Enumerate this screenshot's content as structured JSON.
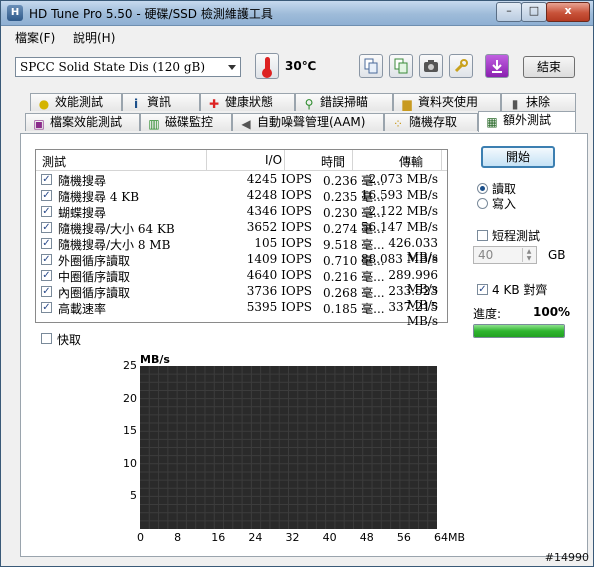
{
  "window": {
    "title": "HD Tune Pro 5.50 - 硬碟/SSD 檢測維護工具",
    "min_label": "–",
    "max_label": "□",
    "close_label": "x"
  },
  "menu": {
    "items": [
      {
        "label": "檔案(F)"
      },
      {
        "label": "說明(H)"
      }
    ]
  },
  "toolbar": {
    "drive": "SPCC Solid State Dis (120 gB)",
    "temperature": "30℃",
    "exit_label": "結束"
  },
  "tabs": {
    "row1": [
      {
        "label": "效能測試",
        "icon": "bulb-icon"
      },
      {
        "label": "資訊",
        "icon": "info-icon"
      },
      {
        "label": "健康狀態",
        "icon": "health-cross-icon"
      },
      {
        "label": "錯誤掃瞄",
        "icon": "magnifier-icon"
      },
      {
        "label": "資料夾使用",
        "icon": "folder-icon"
      },
      {
        "label": "抹除",
        "icon": "trash-icon"
      }
    ],
    "row2": [
      {
        "label": "檔案效能測試",
        "icon": "file-benchmark-icon"
      },
      {
        "label": "磁碟監控",
        "icon": "chart-icon"
      },
      {
        "label": "自動噪聲管理(AAM)",
        "icon": "speaker-icon"
      },
      {
        "label": "隨機存取",
        "icon": "dots-icon"
      },
      {
        "label": "額外測試",
        "icon": "calendar-icon",
        "active": true
      }
    ]
  },
  "table": {
    "headers": {
      "test": "測試",
      "io": "I/O",
      "time": "時間",
      "speed": "傳輸"
    },
    "rows": [
      {
        "name": "隨機搜尋",
        "io": "4245 IOPS",
        "time": "0.236 毫...",
        "speed": "2.073 MB/s"
      },
      {
        "name": "隨機搜尋 4 KB",
        "io": "4248 IOPS",
        "time": "0.235 毫...",
        "speed": "16.593 MB/s"
      },
      {
        "name": "蝴蝶搜尋",
        "io": "4346 IOPS",
        "time": "0.230 毫...",
        "speed": "2.122 MB/s"
      },
      {
        "name": "隨機搜尋/大小 64 KB",
        "io": "3652 IOPS",
        "time": "0.274 毫...",
        "speed": "56.147 MB/s"
      },
      {
        "name": "隨機搜尋/大小 8 MB",
        "io": "105 IOPS",
        "time": "9.518 毫...",
        "speed": "426.033 MB/s"
      },
      {
        "name": "外圈循序讀取",
        "io": "1409 IOPS",
        "time": "0.710 毫...",
        "speed": "88.083 MB/s"
      },
      {
        "name": "中圈循序讀取",
        "io": "4640 IOPS",
        "time": "0.216 毫...",
        "speed": "289.996 MB/s"
      },
      {
        "name": "內圈循序讀取",
        "io": "3736 IOPS",
        "time": "0.268 毫...",
        "speed": "233.523 MB/s"
      },
      {
        "name": "高載速率",
        "io": "5395 IOPS",
        "time": "0.185 毫...",
        "speed": "337.215 MB/s"
      }
    ]
  },
  "cache_label": "快取",
  "side": {
    "start_label": "開始",
    "read_label": "讀取",
    "write_label": "寫入",
    "short_test_label": "短程測試",
    "size_value": "40",
    "size_unit": "GB",
    "align_label": "4 KB 對齊",
    "progress_label": "進度:",
    "progress_value": "100%",
    "progress_fraction": 1.0
  },
  "chart": {
    "unit_label": "MB/s",
    "y_ticks": [
      "25",
      "20",
      "15",
      "10",
      "5"
    ],
    "x_ticks": [
      "0",
      "8",
      "16",
      "24",
      "32",
      "40",
      "48",
      "56",
      "64MB"
    ]
  },
  "watermark": "#14990",
  "colors": {
    "progress": "#2fb52f",
    "chart_bg": "#2a2a2a",
    "grid": "#3c3c3c"
  }
}
